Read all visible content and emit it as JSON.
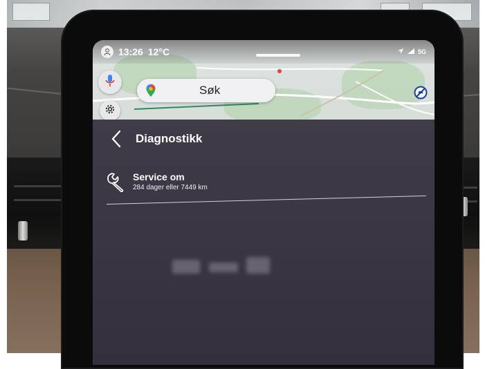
{
  "status_bar": {
    "time": "13:26",
    "temperature": "12°C",
    "network": "5G"
  },
  "map": {
    "search_label": "Søk"
  },
  "page": {
    "title": "Diagnostikk"
  },
  "service": {
    "title": "Service om",
    "detail": "284 dager eller 7449 km"
  },
  "colors": {
    "screen_bg": "#3e3a47",
    "text": "#ffffff",
    "mic_accent": "#4285f4"
  },
  "icons": [
    "profile-icon",
    "location-arrow-icon",
    "signal-icon",
    "microphone-icon",
    "maps-pin-icon",
    "gear-icon",
    "no-parking-icon",
    "back-chevron-icon",
    "wrench-icon"
  ]
}
